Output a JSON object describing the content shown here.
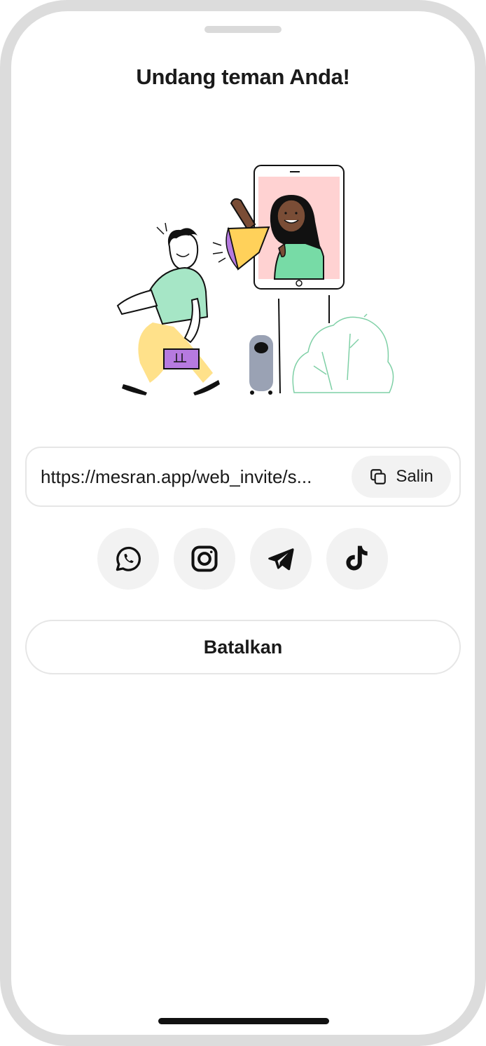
{
  "sheet": {
    "title": "Undang teman Anda!"
  },
  "invite": {
    "link": "https://mesran.app/web_invite/s...",
    "copy_label": "Salin",
    "copy_icon": "copy-icon"
  },
  "share": {
    "targets": [
      {
        "name": "whatsapp",
        "icon": "whatsapp-icon"
      },
      {
        "name": "instagram",
        "icon": "instagram-icon"
      },
      {
        "name": "telegram",
        "icon": "telegram-icon"
      },
      {
        "name": "tiktok",
        "icon": "tiktok-icon"
      }
    ]
  },
  "actions": {
    "cancel_label": "Batalkan"
  },
  "colors": {
    "accent_green": "#a6e6c6",
    "accent_pink": "#ffd2d2",
    "accent_yellow": "#ffe18a",
    "accent_purple": "#b67ae0"
  }
}
